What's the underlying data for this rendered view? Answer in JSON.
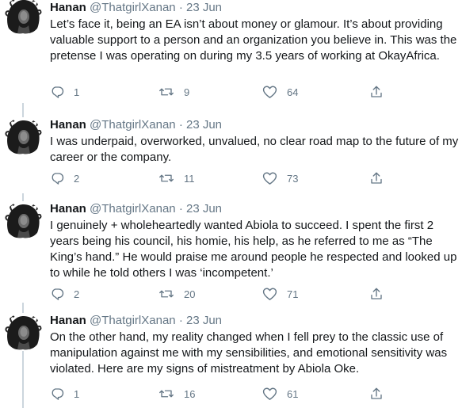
{
  "author": {
    "name": "Hanan",
    "handle": "@ThatgirlXanan",
    "separator": "·"
  },
  "icons": {
    "reply": "reply-icon",
    "retweet": "retweet-icon",
    "like": "heart-icon",
    "share": "share-icon"
  },
  "colors": {
    "text": "#14171a",
    "secondary": "#657786",
    "thread_line": "#ccd6dd"
  },
  "tweets": [
    {
      "date": "23 Jun",
      "text": "Let’s face it, being an EA isn’t about money or glamour. It’s about providing valuable support to a person and an organization you believe in. This was the pretense I was operating on during my 3.5 years of working at OkayAfrica.",
      "replies": "1",
      "retweets": "9",
      "likes": "64"
    },
    {
      "date": "23 Jun",
      "text": "I was underpaid, overworked, unvalued, no clear road map to the future of my career or the company.",
      "replies": "2",
      "retweets": "11",
      "likes": "73"
    },
    {
      "date": "23 Jun",
      "text": "I genuinely + wholeheartedly wanted Abiola to succeed. I spent the first 2 years being his council, his homie, his help, as he referred to me as “The King’s hand.” He would praise me around people he respected and looked up to while he told others I was ‘incompetent.’",
      "replies": "2",
      "retweets": "20",
      "likes": "71"
    },
    {
      "date": "23 Jun",
      "text": "On the other hand, my reality changed when I fell prey to the classic use of manipulation against me with my sensibilities, and emotional sensitivity was violated. Here are my signs of mistreatment by Abiola Oke.",
      "replies": "1",
      "retweets": "16",
      "likes": "61"
    }
  ]
}
